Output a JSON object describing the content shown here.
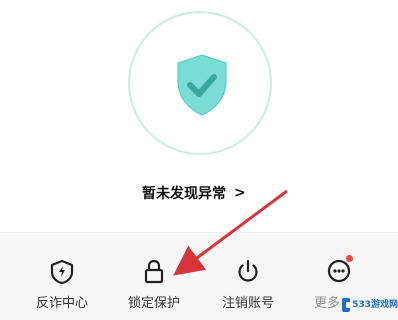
{
  "status": {
    "text": "暂未发现异常",
    "chevron": ">"
  },
  "actions": [
    {
      "label": "反诈中心",
      "icon": "shield-bolt-icon"
    },
    {
      "label": "锁定保护",
      "icon": "lock-icon"
    },
    {
      "label": "注销账号",
      "icon": "power-icon"
    },
    {
      "label": "更多",
      "icon": "more-dots-icon"
    }
  ],
  "colors": {
    "shield": "#79ddd6",
    "ring": "#cfe9e4",
    "arrow": "#d9343a",
    "badge": "#f04848"
  },
  "watermark": {
    "text": "533游戏网"
  }
}
